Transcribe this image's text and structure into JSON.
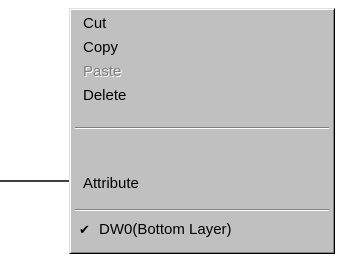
{
  "menu": {
    "items": [
      {
        "label": "Cut",
        "enabled": true
      },
      {
        "label": "Copy",
        "enabled": true
      },
      {
        "label": "Paste",
        "enabled": false
      },
      {
        "label": "Delete",
        "enabled": true
      }
    ],
    "attribute_label": "Attribute",
    "layer_label": "DW0(Bottom Layer)",
    "layer_checked": true,
    "check_glyph": "✔"
  },
  "colors": {
    "menu_face": "#c0c0c0",
    "disabled_text": "#808080",
    "text": "#000000"
  }
}
